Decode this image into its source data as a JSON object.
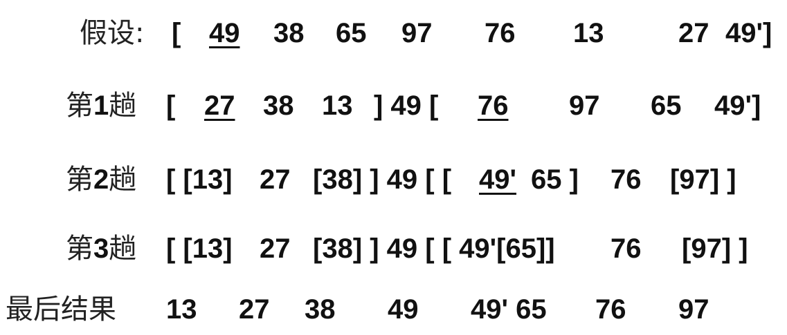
{
  "rows": [
    {
      "label": "假设:",
      "tokens": [
        "[",
        "49",
        "38",
        "65",
        "97",
        "76",
        "13",
        "27",
        "49']"
      ]
    },
    {
      "label_prefix": "第",
      "label_num": "1",
      "label_suffix": "趟",
      "tokens": [
        "[",
        "27",
        "38",
        "13",
        "] 49 [",
        "76",
        "97",
        "65",
        "49']"
      ]
    },
    {
      "label_prefix": "第",
      "label_num": "2",
      "label_suffix": "趟",
      "tokens": [
        "[ [13]",
        "27",
        "[38] ] 49 [ [",
        "49'",
        "65 ]",
        "76",
        "[97] ]"
      ]
    },
    {
      "label_prefix": "第",
      "label_num": "3",
      "label_suffix": "趟",
      "tokens": [
        "[ [13]",
        "27",
        "[38] ] 49 [ [ 49'[65]]",
        "76",
        "[97] ]"
      ]
    },
    {
      "label": "最后结果",
      "tokens": [
        "13",
        "27",
        "38",
        "49",
        "49' 65",
        "76",
        "97"
      ]
    }
  ]
}
